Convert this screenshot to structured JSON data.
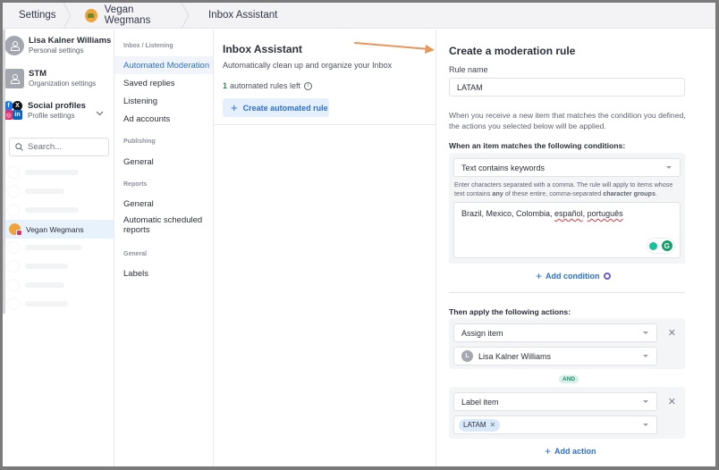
{
  "breadcrumb": {
    "items": [
      "Settings",
      "Vegan Wegmans",
      "Inbox Assistant"
    ]
  },
  "accounts": {
    "personal": {
      "name": "Lisa Kalner Williams",
      "sub": "Personal settings"
    },
    "organization": {
      "name": "STM",
      "sub": "Organization settings"
    },
    "social": {
      "name": "Social profiles",
      "sub": "Profile settings"
    }
  },
  "search": {
    "placeholder": "Search..."
  },
  "profiles": {
    "active": "Vegan Wegmans"
  },
  "settings_nav": {
    "sections": [
      {
        "label": "Inbox / Listening",
        "items": [
          "Automated Moderation",
          "Saved replies",
          "Listening",
          "Ad accounts"
        ]
      },
      {
        "label": "Publishing",
        "items": [
          "General"
        ]
      },
      {
        "label": "Reports",
        "items": [
          "General",
          "Automatic scheduled reports"
        ]
      },
      {
        "label": "General",
        "items": [
          "Labels"
        ]
      }
    ],
    "active_item": "Automated Moderation"
  },
  "inbox_assistant": {
    "title": "Inbox Assistant",
    "description": "Automatically clean up and organize your Inbox",
    "rules_left_count": "1",
    "rules_left_text": "automated rules left",
    "create_button": "Create automated rule"
  },
  "rule_form": {
    "title": "Create a moderation rule",
    "rule_name_label": "Rule name",
    "rule_name_value": "LATAM",
    "description": "When you receive a new item that matches the condition you defined, the actions you selected below will be applied.",
    "conditions_heading": "When an item matches the following conditions:",
    "condition_type": "Text contains keywords",
    "condition_help_1": "Enter characters separated with a comma. The rule will apply to items whose text contains ",
    "condition_help_any": "any",
    "condition_help_2": " of these entire, comma-separated ",
    "condition_help_groups": "character groups",
    "condition_help_end": ".",
    "keywords_plain": "Brazil, Mexico, Colombia, ",
    "keyword_es": "español",
    "keyword_sep": ", ",
    "keyword_pt": "português",
    "add_condition": "Add condition",
    "actions_heading": "Then apply the following actions:",
    "actions": [
      {
        "type": "Assign item",
        "value": "Lisa Kalner Williams",
        "avatar_letter": "L"
      },
      {
        "type": "Label item",
        "tag": "LATAM"
      }
    ],
    "and_label": "AND",
    "add_action": "Add action"
  },
  "colors": {
    "accent": "#2a6fd6",
    "annotation_arrow": "#e8965a",
    "and_chip": "#1f8a6e"
  }
}
